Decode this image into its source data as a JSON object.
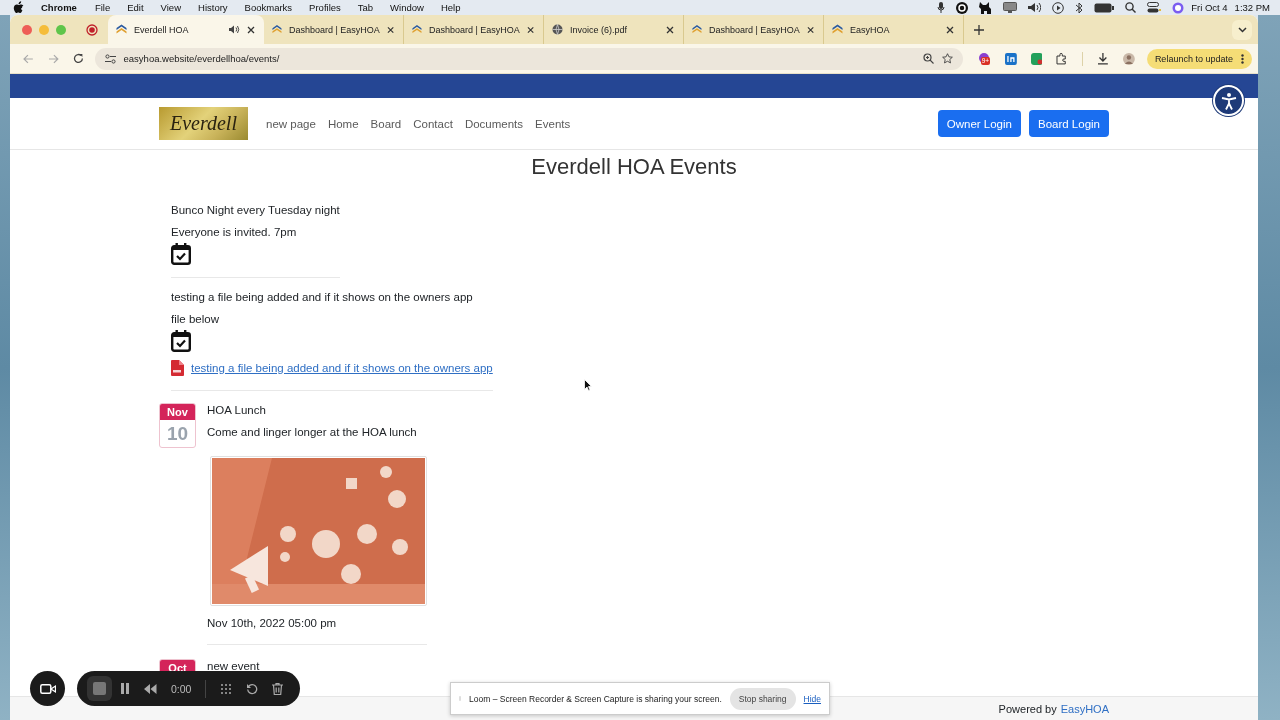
{
  "menu_bar": {
    "app": "Chrome",
    "menus": [
      "File",
      "Edit",
      "View",
      "History",
      "Bookmarks",
      "Profiles",
      "Tab",
      "Window",
      "Help"
    ],
    "date": "Fri Oct 4",
    "time": "1:32 PM"
  },
  "tabs": [
    {
      "title": "Everdell HOA",
      "selected": true,
      "kind": "hoa",
      "audio": true
    },
    {
      "title": "Dashboard | EasyHOA",
      "selected": false,
      "kind": "hoa",
      "audio": false
    },
    {
      "title": "Dashboard | EasyHOA",
      "selected": false,
      "kind": "hoa",
      "audio": false
    },
    {
      "title": "Invoice (6).pdf",
      "selected": false,
      "kind": "globe",
      "audio": false
    },
    {
      "title": "Dashboard | EasyHOA",
      "selected": false,
      "kind": "hoa",
      "audio": false
    },
    {
      "title": "EasyHOA",
      "selected": false,
      "kind": "hoa",
      "audio": false
    }
  ],
  "address_bar": {
    "url": "easyhoa.website/everdellhoa/events/"
  },
  "extension_badge": "9+",
  "relaunch_button": "Relaunch to update",
  "site": {
    "logo": "Everdell",
    "nav": [
      "new page",
      "Home",
      "Board",
      "Contact",
      "Documents",
      "Events"
    ],
    "buttons": [
      "Owner Login",
      "Board Login"
    ]
  },
  "page_title": "Everdell HOA Events",
  "events": [
    {
      "kind": "recurring",
      "title": "Bunco Night every Tuesday night",
      "description": "Everyone is invited. 7pm"
    },
    {
      "kind": "recurring",
      "title": "testing a file being added and if it shows on the owners app",
      "description": "file below",
      "attachment": "testing a file being added and if it shows on the owners app"
    },
    {
      "kind": "dated",
      "month": "Nov",
      "day": "10",
      "title": "HOA Lunch",
      "description": "Come and linger longer at the HOA lunch",
      "datetime": "Nov 10th, 2022 05:00 pm"
    },
    {
      "kind": "dated",
      "month": "Oct",
      "title": "new event"
    }
  ],
  "recorder": {
    "time": "0:00"
  },
  "share_notice": {
    "message": "Loom – Screen Recorder & Screen Capture is sharing your screen.",
    "stop": "Stop sharing",
    "hide": "Hide"
  },
  "footer": {
    "prefix": "Powered by",
    "link": "EasyHOA"
  }
}
